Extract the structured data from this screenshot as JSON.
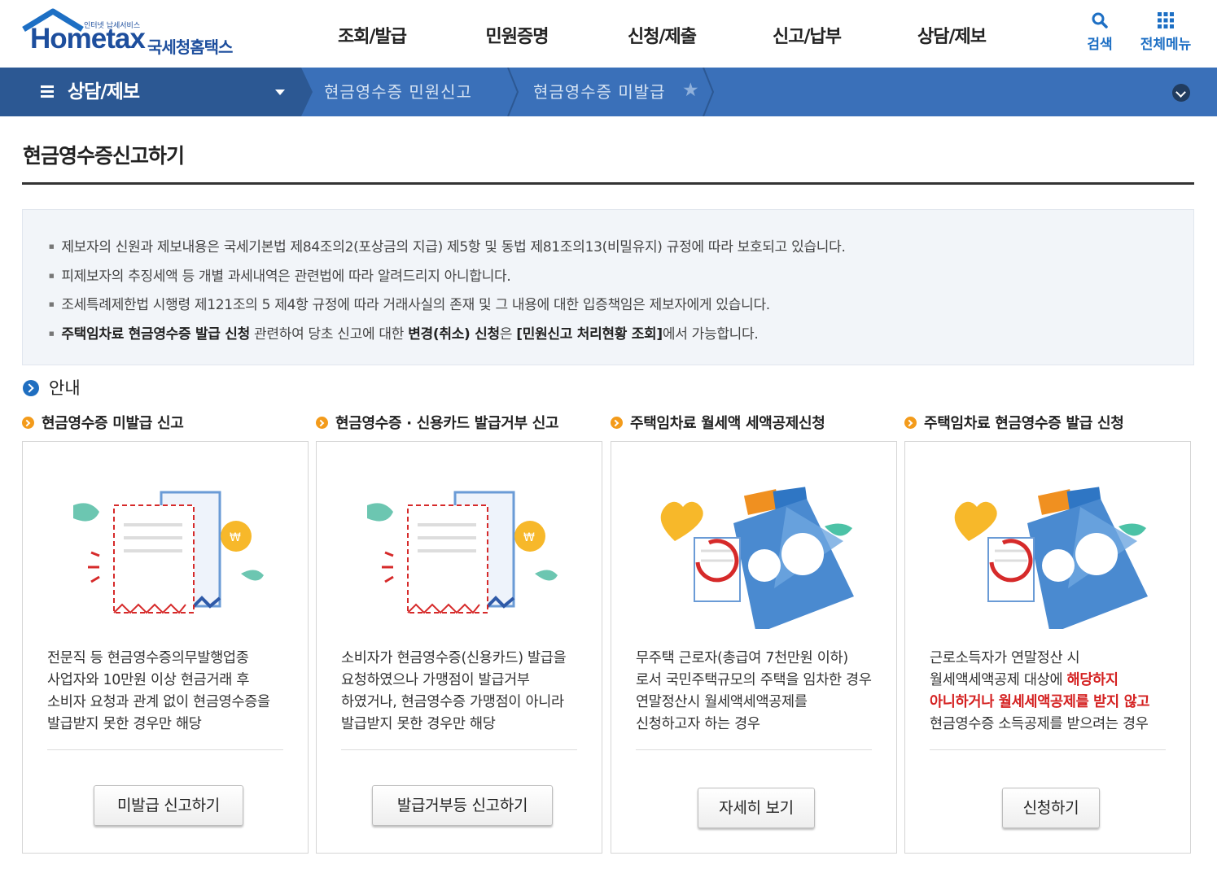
{
  "header": {
    "logo_text": "Hometax",
    "logo_kor": "국세청홈택스",
    "logo_tagline": "인터넷 납세서비스",
    "gnb": [
      "조회/발급",
      "민원증명",
      "신청/제출",
      "신고/납부",
      "상담/제보"
    ],
    "search_label": "검색",
    "allmenu_label": "전체메뉴"
  },
  "locbar": {
    "title": "상담/제보",
    "crumbs": [
      "현금영수증 민원신고",
      "현금영수증 미발급"
    ]
  },
  "page_title": "현금영수증신고하기",
  "notice": [
    {
      "text": "제보자의 신원과 제보내용은 국세기본법 제84조의2(포상금의 지급) 제5항 및 동법 제81조의13(비밀유지) 규정에 따라 보호되고 있습니다."
    },
    {
      "text": "피제보자의 추징세액 등 개별 과세내역은 관련법에 따라 알려드리지 아니합니다."
    },
    {
      "text": "조세특례제한법 시행령 제121조의 5 제4항 규정에 따라 거래사실의 존재 및 그 내용에 대한 입증책임은 제보자에게 있습니다."
    },
    {
      "p1": "주택임차료 현금영수증 발급 신청",
      "p2": " 관련하여 당초 신고에 대한 ",
      "p3": "변경(취소) 신청",
      "p4": "은 ",
      "p5": "[민원신고 처리현황 조회]",
      "p6": "에서 가능합니다."
    }
  ],
  "guide_heading": "안내",
  "cards": [
    {
      "title": "현금영수증 미발급 신고",
      "desc": "전문직 등 현금영수증의무발행업종 사업자와 10만원 이상 현금거래 후 소비자 요청과 관계 없이 현금영수증을 발급받지 못한 경우만 해당",
      "button": "미발급 신고하기"
    },
    {
      "title": "현금영수증 · 신용카드 발급거부 신고",
      "desc": "소비자가 현금영수증(신용카드) 발급을 요청하였으나 가맹점이 발급거부 하였거나, 현금영수증 가맹점이 아니라 발급받지 못한 경우만 해당",
      "button": "발급거부등 신고하기"
    },
    {
      "title": "주택임차료 월세액 세액공제신청",
      "desc": "무주택 근로자(총급여 7천만원 이하)로서 국민주택규모의 주택을 임차한 경우 연말정산시 월세액세액공제를 신청하고자 하는 경우",
      "button": "자세히 보기"
    },
    {
      "title": "주택임차료 현금영수증 발급 신청",
      "desc_a": "근로소득자가 연말정산 시 월세액세액공제 대상에 ",
      "desc_red": "해당하지 아니하거나 월세세액공제를 받지 않고",
      "desc_b": " 현금영수증 소득공제를 받으려는 경우",
      "button": "신청하기"
    }
  ]
}
